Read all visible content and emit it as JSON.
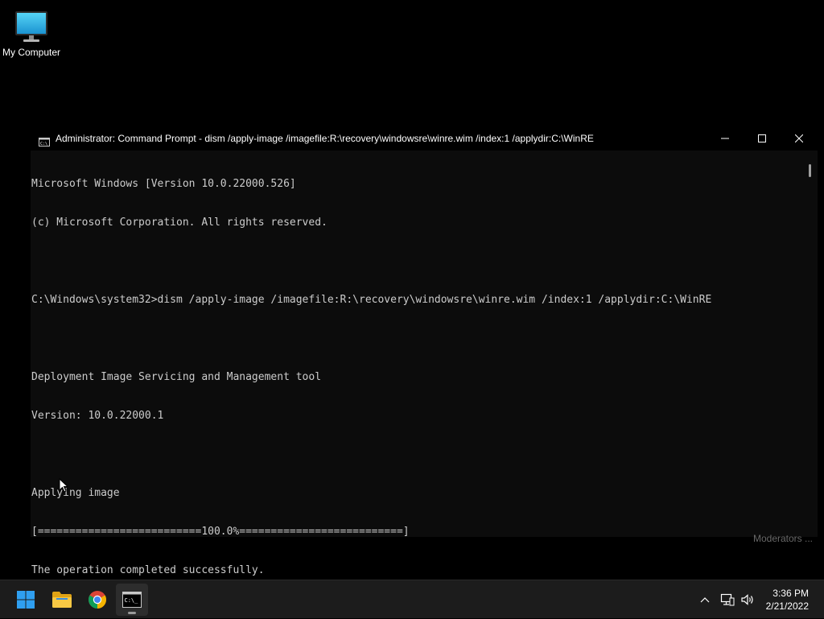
{
  "desktop": {
    "icons": [
      {
        "label": "My Computer",
        "icon": "monitor-icon"
      }
    ],
    "watermark": "Moderators ..."
  },
  "window": {
    "title": "Administrator: Command Prompt - dism  /apply-image /imagefile:R:\\recovery\\windowsre\\winre.wim /index:1 /applydir:C:\\WinRE",
    "icon": "cmd-icon",
    "controls": [
      "minimize-icon",
      "maximize-icon",
      "close-icon"
    ]
  },
  "console": {
    "lines": [
      "Microsoft Windows [Version 10.0.22000.526]",
      "(c) Microsoft Corporation. All rights reserved.",
      "",
      "C:\\Windows\\system32>dism /apply-image /imagefile:R:\\recovery\\windowsre\\winre.wim /index:1 /applydir:C:\\WinRE",
      "",
      "Deployment Image Servicing and Management tool",
      "Version: 10.0.22000.1",
      "",
      "Applying image",
      "[==========================100.0%==========================]",
      "The operation completed successfully."
    ],
    "colors": {
      "background": "#0c0c0c",
      "text": "#cccccc"
    }
  },
  "taskbar": {
    "apps": [
      {
        "name": "start",
        "icon": "windows-logo-icon"
      },
      {
        "name": "file-explorer",
        "icon": "folder-icon"
      },
      {
        "name": "chrome",
        "icon": "chrome-icon"
      },
      {
        "name": "command-prompt",
        "icon": "cmd-icon",
        "active": true
      }
    ],
    "tray": {
      "icons": [
        "chevron-up-icon",
        "network-icon",
        "volume-icon"
      ],
      "time": "3:36 PM",
      "date": "2/21/2022"
    }
  }
}
